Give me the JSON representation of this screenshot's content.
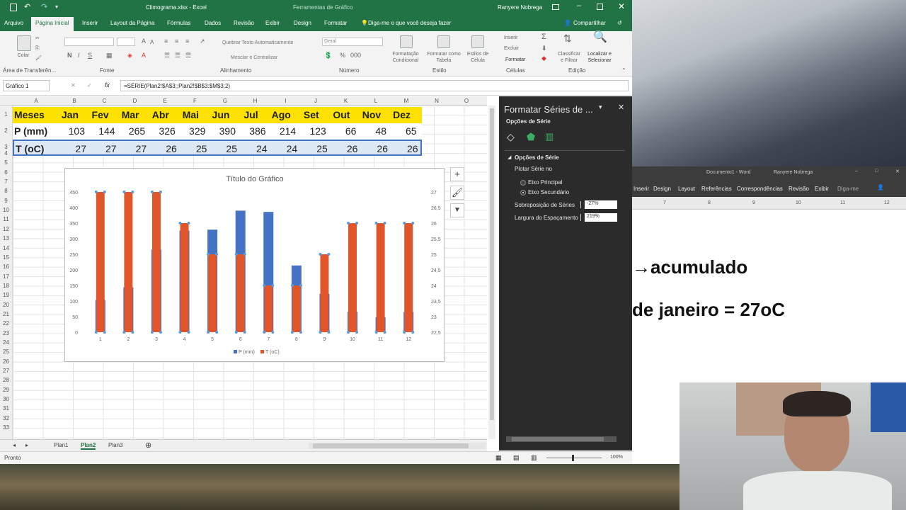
{
  "excel": {
    "title": "Climograma.xlsx  -  Excel",
    "context_tab": "Ferramentas de Gráfico",
    "user": "Ranyere Nobrega",
    "tabs": [
      "Arquivo",
      "Página Inicial",
      "Inserir",
      "Layout da Página",
      "Fórmulas",
      "Dados",
      "Revisão",
      "Exibir",
      "Design",
      "Formatar"
    ],
    "tell_me": "Diga-me o que você deseja fazer",
    "share": "Compartilhar",
    "groups": {
      "clipboard": "Área de Transferên...",
      "font": "Fonte",
      "align": "Alinhamento",
      "number": "Número",
      "styles": "Estilo",
      "cells": "Células",
      "edit": "Edição"
    },
    "ribbon_labels": {
      "paste": "Colar",
      "wrap": "Quebrar Texto Automaticamente",
      "merge": "Mesclar e Centralizar",
      "numfmt": "Geral",
      "cond": "Formatação Condicional",
      "fmt_table": "Formatar como Tabela",
      "cell_styles": "Estilos de Célula",
      "insert": "Inserir",
      "delete": "Excluir",
      "format": "Formatar",
      "sort": "Classificar e Filtrar",
      "find": "Localizar e Selecionar"
    },
    "name_box": "Gráfico 1",
    "formula": "=SÉRIE(Plan2!$A$3;;Plan2!$B$3:$M$3;2)",
    "columns": [
      "A",
      "B",
      "C",
      "D",
      "E",
      "F",
      "G",
      "H",
      "I",
      "J",
      "K",
      "L",
      "M",
      "N",
      "O"
    ],
    "rows": [
      "1",
      "2",
      "3",
      "4",
      "5",
      "6",
      "7",
      "8",
      "9",
      "10",
      "11",
      "12",
      "13",
      "14",
      "15",
      "16",
      "17",
      "18",
      "19",
      "20",
      "21",
      "22",
      "23",
      "24",
      "25",
      "26",
      "27",
      "28",
      "29",
      "30",
      "31",
      "32",
      "33"
    ],
    "table": {
      "header": [
        "Meses",
        "Jan",
        "Fev",
        "Mar",
        "Abr",
        "Mai",
        "Jun",
        "Jul",
        "Ago",
        "Set",
        "Out",
        "Nov",
        "Dez"
      ],
      "p_label": "P (mm)",
      "p_values": [
        "103",
        "144",
        "265",
        "326",
        "329",
        "390",
        "386",
        "214",
        "123",
        "66",
        "48",
        "65"
      ],
      "t_label": "T (oC)",
      "t_values": [
        "27",
        "27",
        "27",
        "26",
        "25",
        "25",
        "24",
        "24",
        "25",
        "26",
        "26",
        "26"
      ]
    },
    "sheets": [
      "Plan1",
      "Plan2",
      "Plan3"
    ],
    "status": "Pronto",
    "zoom": "100%"
  },
  "chart_data": {
    "type": "bar",
    "title": "Título do Gráfico",
    "categories": [
      "1",
      "2",
      "3",
      "4",
      "5",
      "6",
      "7",
      "8",
      "9",
      "10",
      "11",
      "12"
    ],
    "series": [
      {
        "name": "P (mm)",
        "axis": "primary",
        "values": [
          103,
          144,
          265,
          326,
          329,
          390,
          386,
          214,
          123,
          66,
          48,
          65
        ],
        "color": "#4472c4"
      },
      {
        "name": "T (oC)",
        "axis": "secondary",
        "values": [
          27,
          27,
          27,
          26,
          25,
          25,
          24,
          24,
          25,
          26,
          26,
          26
        ],
        "color": "#e0562a"
      }
    ],
    "y_primary": {
      "min": 0,
      "max": 450,
      "ticks": [
        "0",
        "50",
        "100",
        "150",
        "200",
        "250",
        "300",
        "350",
        "400",
        "450"
      ]
    },
    "y_secondary": {
      "min": 22.5,
      "max": 27,
      "ticks": [
        "22,5",
        "23",
        "23,5",
        "24",
        "24,5",
        "25",
        "25,5",
        "26",
        "26,5",
        "27"
      ]
    },
    "legend": [
      "P (mm)",
      "T (oC)"
    ],
    "legend_position": "bottom"
  },
  "pane": {
    "title": "Formatar Séries de ...",
    "subtitle": "Opções de Série",
    "section": "Opções de Série",
    "plot_on": "Plotar Série no",
    "primary": "Eixo Principal",
    "secondary": "Eixo Secundário",
    "overlap_label": "Sobreposição de Séries",
    "overlap_value": "-27%",
    "gap_label": "Largura do Espaçamento",
    "gap_value": "219%"
  },
  "word": {
    "title": "Documento1  -  Word",
    "user": "Ranyere Nobrega",
    "tabs": [
      "Inserir",
      "Design",
      "Layout",
      "Referências",
      "Correspondências",
      "Revisão",
      "Exibir",
      "Diga-me"
    ],
    "ruler": [
      "7",
      "8",
      "9",
      "10",
      "11",
      "12"
    ],
    "line1": "→acumulado",
    "line2": "de janeiro = 27oC"
  }
}
